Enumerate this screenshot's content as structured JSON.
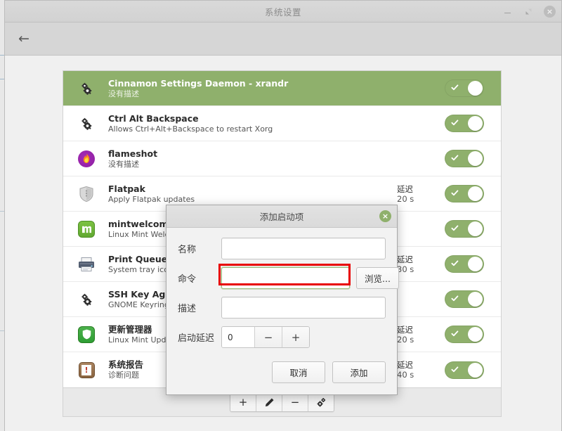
{
  "window": {
    "title": "系统设置",
    "controls": {
      "minimize": "−",
      "maximize": "maximize-icon",
      "close": "×"
    },
    "back_arrow": "←"
  },
  "list": {
    "rows": [
      {
        "name": "Cinnamon Settings Daemon - xrandr",
        "desc": "没有描述",
        "icon": "gears-icon",
        "delay_label": "",
        "delay_value": "",
        "selected": true,
        "toggle_on": true
      },
      {
        "name": "Ctrl Alt Backspace",
        "desc": "Allows Ctrl+Alt+Backspace to restart Xorg",
        "icon": "gears-icon",
        "delay_label": "",
        "delay_value": "",
        "selected": false,
        "toggle_on": true
      },
      {
        "name": "flameshot",
        "desc": "没有描述",
        "icon": "flameshot-icon",
        "delay_label": "",
        "delay_value": "",
        "selected": false,
        "toggle_on": true
      },
      {
        "name": "Flatpak",
        "desc": "Apply Flatpak updates",
        "icon": "shield-gray-icon",
        "delay_label": "延迟",
        "delay_value": "20 s",
        "selected": false,
        "toggle_on": true
      },
      {
        "name": "mintwelcome",
        "desc": "Linux Mint Welcome Screen",
        "icon": "mint-icon",
        "delay_label": "",
        "delay_value": "",
        "selected": false,
        "toggle_on": true
      },
      {
        "name": "Print Queue Applet",
        "desc": "System tray icon for print jobs",
        "icon": "printer-icon",
        "delay_label": "延迟",
        "delay_value": "30 s",
        "selected": false,
        "toggle_on": true
      },
      {
        "name": "SSH Key Agent",
        "desc": "GNOME Keyring: SSH Agent",
        "icon": "gears-icon",
        "delay_label": "",
        "delay_value": "",
        "selected": false,
        "toggle_on": true
      },
      {
        "name": "更新管理器",
        "desc": "Linux Mint Update Manager",
        "icon": "update-shield-icon",
        "delay_label": "延迟",
        "delay_value": "20 s",
        "selected": false,
        "toggle_on": true
      },
      {
        "name": "系统报告",
        "desc": "诊断问题",
        "icon": "report-icon",
        "delay_label": "延迟",
        "delay_value": "40 s",
        "selected": false,
        "toggle_on": true
      }
    ]
  },
  "footer": {
    "add": "+",
    "edit": "pencil-icon",
    "remove": "−",
    "settings": "gear-icon"
  },
  "dialog": {
    "title": "添加启动项",
    "close": "×",
    "fields": {
      "name_label": "名称",
      "name_value": "",
      "name_placeholder": "",
      "command_label": "命令",
      "command_value": "",
      "command_placeholder": "",
      "browse_label": "浏览...",
      "description_label": "描述",
      "description_value": "",
      "description_placeholder": "",
      "delay_label": "启动延迟",
      "delay_value": "0",
      "delay_minus": "−",
      "delay_plus": "+"
    },
    "cancel_label": "取消",
    "add_label": "添加"
  },
  "colors": {
    "accent_green": "#8fb06c",
    "highlight_red": "#e80000",
    "window_bg": "#f0f0f0"
  }
}
